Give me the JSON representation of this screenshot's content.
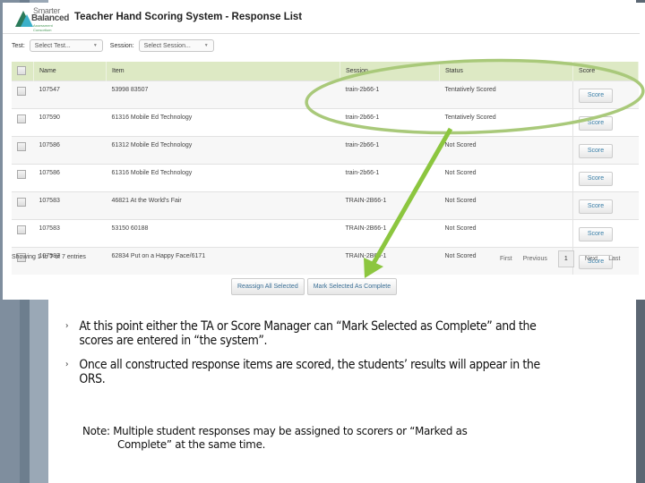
{
  "app": {
    "logo_line1": "Smarter",
    "logo_line2": "Balanced",
    "logo_line3": "Assessment Consortium",
    "title": "Teacher Hand Scoring System - Response List"
  },
  "filters": {
    "test_label": "Test:",
    "test_value": "Select Test...",
    "session_label": "Session:",
    "session_value": "Select Session..."
  },
  "table": {
    "columns": [
      "Name",
      "Item",
      "Session",
      "Status",
      "Score"
    ],
    "rows": [
      {
        "name": "107547",
        "item": "53998 83507",
        "session": "train-2b66-1",
        "status": "Tentatively Scored",
        "action": "Score"
      },
      {
        "name": "107590",
        "item": "61316 Mobile Ed Technology",
        "session": "train-2b66-1",
        "status": "Tentatively Scored",
        "action": "Score"
      },
      {
        "name": "107586",
        "item": "61312 Mobile Ed Technology",
        "session": "train-2b66-1",
        "status": "Not Scored",
        "action": "Score"
      },
      {
        "name": "107586",
        "item": "61316 Mobile Ed Technology",
        "session": "train-2b66-1",
        "status": "Not Scored",
        "action": "Score"
      },
      {
        "name": "107583",
        "item": "46821 At the World's Fair",
        "session": "TRAIN-2B66-1",
        "status": "Not Scored",
        "action": "Score"
      },
      {
        "name": "107583",
        "item": "53150 60188",
        "session": "TRAIN-2B66-1",
        "status": "Not Scored",
        "action": "Score"
      },
      {
        "name": "107583",
        "item": "62834 Put on a Happy Face/6171",
        "session": "TRAIN-2B66-1",
        "status": "Not Scored",
        "action": "Score"
      }
    ]
  },
  "footer": {
    "info": "Showing 1 to 7 of 7 entries",
    "pager": {
      "first": "First",
      "previous": "Previous",
      "current": "1",
      "next": "Next",
      "last": "Last"
    },
    "reassign_label": "Reassign All Selected",
    "mark_complete_label": "Mark Selected As Complete"
  },
  "annotation": {
    "color": "#8cc63f",
    "ellipse_color": "#a9c97a"
  },
  "slide": {
    "bullet_marker": "›",
    "bullets": [
      "At this point either the TA or Score Manager can “Mark Selected as Complete” and the scores are entered in “the system”.",
      "Once all constructed response items are scored, the students’ results will appear in the ORS."
    ],
    "note_label": "Note:",
    "note_line1": "Multiple student responses may be assigned to scorers or “Marked as",
    "note_line2": "Complete” at the same time."
  }
}
